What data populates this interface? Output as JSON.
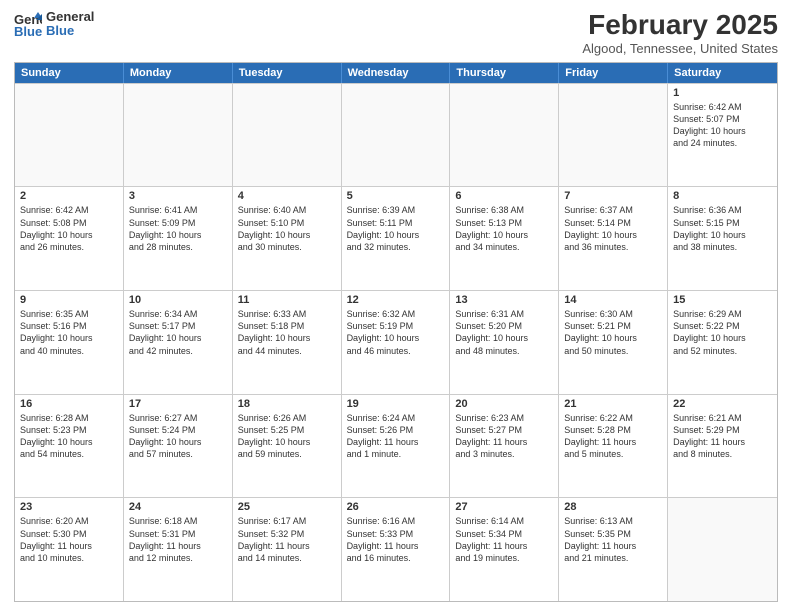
{
  "header": {
    "logo_general": "General",
    "logo_blue": "Blue",
    "month_title": "February 2025",
    "location": "Algood, Tennessee, United States"
  },
  "days_of_week": [
    "Sunday",
    "Monday",
    "Tuesday",
    "Wednesday",
    "Thursday",
    "Friday",
    "Saturday"
  ],
  "weeks": [
    [
      {
        "day": "",
        "empty": true
      },
      {
        "day": "",
        "empty": true
      },
      {
        "day": "",
        "empty": true
      },
      {
        "day": "",
        "empty": true
      },
      {
        "day": "",
        "empty": true
      },
      {
        "day": "",
        "empty": true
      },
      {
        "day": "1",
        "text": "Sunrise: 6:42 AM\nSunset: 5:07 PM\nDaylight: 10 hours\nand 24 minutes."
      }
    ],
    [
      {
        "day": "2",
        "text": "Sunrise: 6:42 AM\nSunset: 5:08 PM\nDaylight: 10 hours\nand 26 minutes."
      },
      {
        "day": "3",
        "text": "Sunrise: 6:41 AM\nSunset: 5:09 PM\nDaylight: 10 hours\nand 28 minutes."
      },
      {
        "day": "4",
        "text": "Sunrise: 6:40 AM\nSunset: 5:10 PM\nDaylight: 10 hours\nand 30 minutes."
      },
      {
        "day": "5",
        "text": "Sunrise: 6:39 AM\nSunset: 5:11 PM\nDaylight: 10 hours\nand 32 minutes."
      },
      {
        "day": "6",
        "text": "Sunrise: 6:38 AM\nSunset: 5:13 PM\nDaylight: 10 hours\nand 34 minutes."
      },
      {
        "day": "7",
        "text": "Sunrise: 6:37 AM\nSunset: 5:14 PM\nDaylight: 10 hours\nand 36 minutes."
      },
      {
        "day": "8",
        "text": "Sunrise: 6:36 AM\nSunset: 5:15 PM\nDaylight: 10 hours\nand 38 minutes."
      }
    ],
    [
      {
        "day": "9",
        "text": "Sunrise: 6:35 AM\nSunset: 5:16 PM\nDaylight: 10 hours\nand 40 minutes."
      },
      {
        "day": "10",
        "text": "Sunrise: 6:34 AM\nSunset: 5:17 PM\nDaylight: 10 hours\nand 42 minutes."
      },
      {
        "day": "11",
        "text": "Sunrise: 6:33 AM\nSunset: 5:18 PM\nDaylight: 10 hours\nand 44 minutes."
      },
      {
        "day": "12",
        "text": "Sunrise: 6:32 AM\nSunset: 5:19 PM\nDaylight: 10 hours\nand 46 minutes."
      },
      {
        "day": "13",
        "text": "Sunrise: 6:31 AM\nSunset: 5:20 PM\nDaylight: 10 hours\nand 48 minutes."
      },
      {
        "day": "14",
        "text": "Sunrise: 6:30 AM\nSunset: 5:21 PM\nDaylight: 10 hours\nand 50 minutes."
      },
      {
        "day": "15",
        "text": "Sunrise: 6:29 AM\nSunset: 5:22 PM\nDaylight: 10 hours\nand 52 minutes."
      }
    ],
    [
      {
        "day": "16",
        "text": "Sunrise: 6:28 AM\nSunset: 5:23 PM\nDaylight: 10 hours\nand 54 minutes."
      },
      {
        "day": "17",
        "text": "Sunrise: 6:27 AM\nSunset: 5:24 PM\nDaylight: 10 hours\nand 57 minutes."
      },
      {
        "day": "18",
        "text": "Sunrise: 6:26 AM\nSunset: 5:25 PM\nDaylight: 10 hours\nand 59 minutes."
      },
      {
        "day": "19",
        "text": "Sunrise: 6:24 AM\nSunset: 5:26 PM\nDaylight: 11 hours\nand 1 minute."
      },
      {
        "day": "20",
        "text": "Sunrise: 6:23 AM\nSunset: 5:27 PM\nDaylight: 11 hours\nand 3 minutes."
      },
      {
        "day": "21",
        "text": "Sunrise: 6:22 AM\nSunset: 5:28 PM\nDaylight: 11 hours\nand 5 minutes."
      },
      {
        "day": "22",
        "text": "Sunrise: 6:21 AM\nSunset: 5:29 PM\nDaylight: 11 hours\nand 8 minutes."
      }
    ],
    [
      {
        "day": "23",
        "text": "Sunrise: 6:20 AM\nSunset: 5:30 PM\nDaylight: 11 hours\nand 10 minutes."
      },
      {
        "day": "24",
        "text": "Sunrise: 6:18 AM\nSunset: 5:31 PM\nDaylight: 11 hours\nand 12 minutes."
      },
      {
        "day": "25",
        "text": "Sunrise: 6:17 AM\nSunset: 5:32 PM\nDaylight: 11 hours\nand 14 minutes."
      },
      {
        "day": "26",
        "text": "Sunrise: 6:16 AM\nSunset: 5:33 PM\nDaylight: 11 hours\nand 16 minutes."
      },
      {
        "day": "27",
        "text": "Sunrise: 6:14 AM\nSunset: 5:34 PM\nDaylight: 11 hours\nand 19 minutes."
      },
      {
        "day": "28",
        "text": "Sunrise: 6:13 AM\nSunset: 5:35 PM\nDaylight: 11 hours\nand 21 minutes."
      },
      {
        "day": "",
        "empty": true
      }
    ]
  ]
}
